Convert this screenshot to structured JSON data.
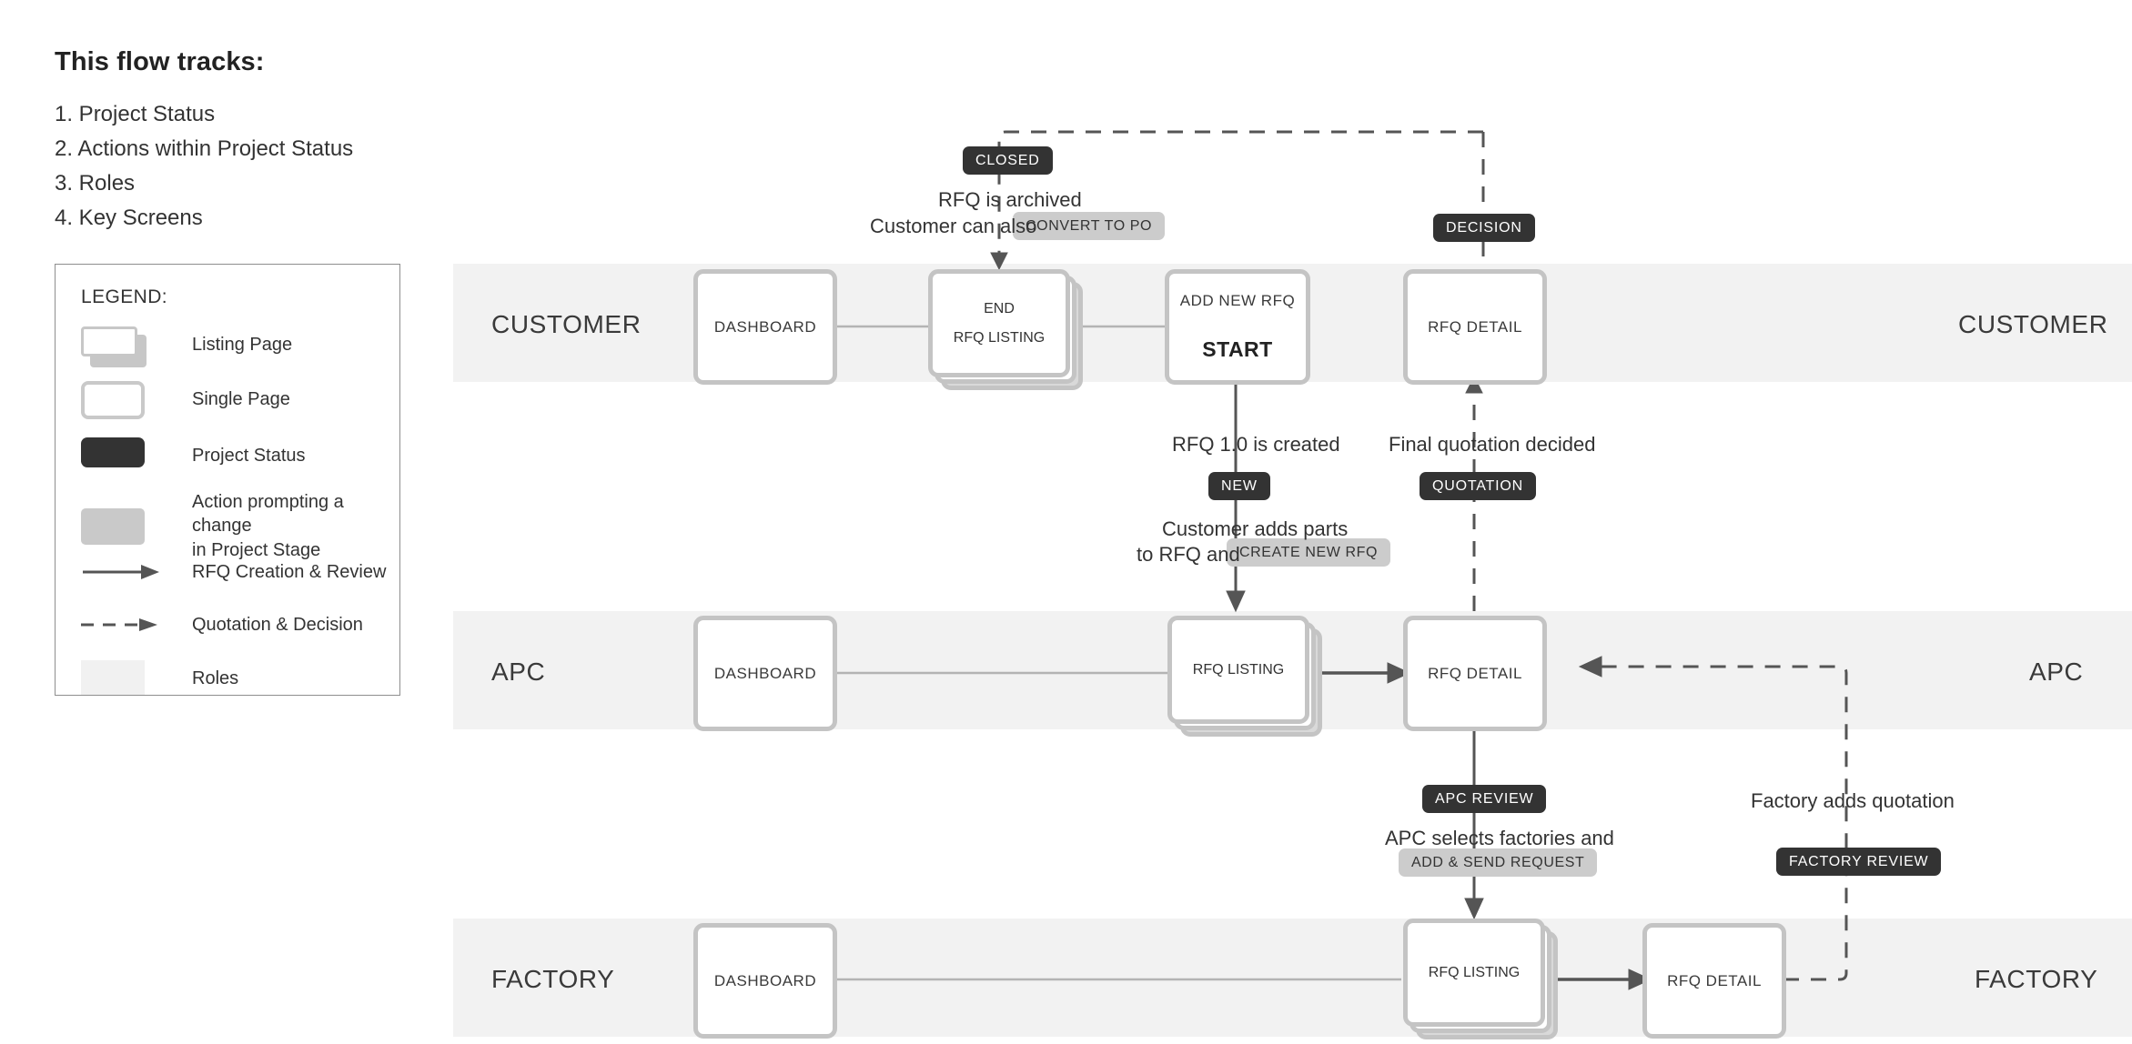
{
  "intro": {
    "title": "This flow tracks:",
    "items": [
      "1. Project Status",
      "2. Actions within Project Status",
      "3. Roles",
      "4. Key Screens"
    ]
  },
  "legend": {
    "title": "LEGEND:",
    "items": [
      {
        "swatch": "listing-page-swatch",
        "label": "Listing Page"
      },
      {
        "swatch": "single-page-swatch",
        "label": "Single Page"
      },
      {
        "swatch": "project-status-swatch",
        "label": "Project Status"
      },
      {
        "swatch": "action-swatch",
        "label": "Action prompting a change\nin Project Stage"
      },
      {
        "swatch": "solid-arrow-swatch",
        "label": "RFQ Creation & Review"
      },
      {
        "swatch": "dashed-arrow-swatch",
        "label": "Quotation & Decision"
      },
      {
        "swatch": "roles-swatch",
        "label": "Roles"
      }
    ]
  },
  "lanes": [
    {
      "name": "customer",
      "label_left": "CUSTOMER",
      "label_right": "CUSTOMER"
    },
    {
      "name": "apc",
      "label_left": "APC",
      "label_right": "APC"
    },
    {
      "name": "factory",
      "label_left": "FACTORY",
      "label_right": "FACTORY"
    }
  ],
  "nodes": {
    "customer_dashboard": "DASHBOARD",
    "customer_rfq_listing": "RFQ LISTING",
    "customer_rfq_listing_end": "END",
    "customer_add_new_rfq": "ADD NEW RFQ",
    "customer_add_new_rfq_start": "START",
    "customer_rfq_detail": "RFQ DETAIL",
    "apc_dashboard": "DASHBOARD",
    "apc_rfq_listing": "RFQ LISTING",
    "apc_rfq_detail": "RFQ DETAIL",
    "factory_dashboard": "DASHBOARD",
    "factory_rfq_listing": "RFQ LISTING",
    "factory_rfq_detail": "RFQ DETAIL"
  },
  "statuses": {
    "closed": "CLOSED",
    "decision": "DECISION",
    "new": "NEW",
    "quotation": "QUOTATION",
    "apc_review": "APC REVIEW",
    "factory_review": "FACTORY REVIEW"
  },
  "actions": {
    "convert_to_po": "CONVERT TO PO",
    "create_new_rfq": "CREATE NEW RFQ",
    "add_send_request": "ADD & SEND REQUEST"
  },
  "annotations": {
    "rfq_archived": "RFQ is archived",
    "customer_can_also": "Customer can also",
    "rfq_created": "RFQ 1.0 is created",
    "customer_adds_parts": "Customer adds parts",
    "to_rfq_and": "to RFQ and",
    "final_quotation": "Final quotation decided",
    "apc_selects": "APC selects factories and",
    "factory_adds_quotation": "Factory adds quotation"
  },
  "colors": {
    "status_bg": "#333333",
    "action_bg": "#cccccc",
    "lane_bg": "#f2f2f2",
    "node_border": "#c4c4c4",
    "wire": "#555555"
  }
}
